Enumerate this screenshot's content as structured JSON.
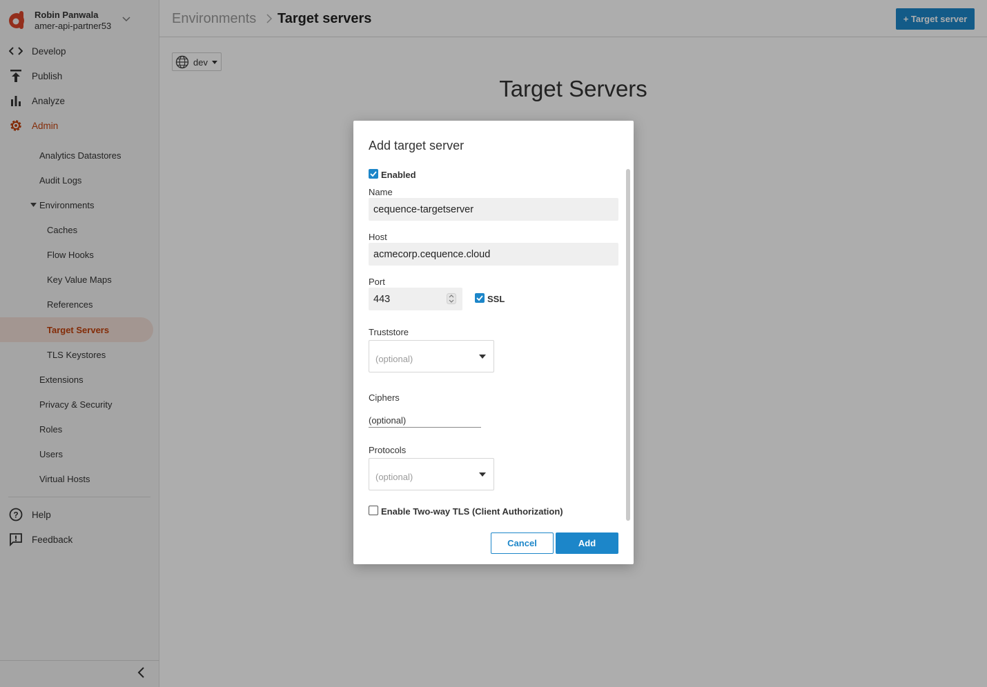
{
  "user": {
    "name": "Robin Panwala",
    "org": "amer-api-partner53"
  },
  "nav": [
    {
      "label": "Develop",
      "icon": "code-icon"
    },
    {
      "label": "Publish",
      "icon": "publish-icon"
    },
    {
      "label": "Analyze",
      "icon": "bar-chart-icon"
    },
    {
      "label": "Admin",
      "icon": "gear-icon",
      "active": true
    }
  ],
  "admin_items": {
    "analytics_datastores": "Analytics Datastores",
    "audit_logs": "Audit Logs",
    "environments": "Environments",
    "caches": "Caches",
    "flow_hooks": "Flow Hooks",
    "key_value_maps": "Key Value Maps",
    "references": "References",
    "target_servers": "Target Servers",
    "tls_keystores": "TLS Keystores",
    "extensions": "Extensions",
    "privacy_security": "Privacy & Security",
    "roles": "Roles",
    "users": "Users",
    "virtual_hosts": "Virtual Hosts"
  },
  "footer_nav": {
    "help": "Help",
    "feedback": "Feedback"
  },
  "header": {
    "breadcrumb_parent": "Environments",
    "breadcrumb_current": "Target servers",
    "add_button": "+ Target server"
  },
  "main": {
    "env_value": "dev",
    "heading": "Target Servers"
  },
  "dialog": {
    "title": "Add target server",
    "enabled_label": "Enabled",
    "name_label": "Name",
    "name_value": "cequence-targetserver",
    "host_label": "Host",
    "host_value": "acmecorp.cequence.cloud",
    "port_label": "Port",
    "port_value": "443",
    "ssl_label": "SSL",
    "truststore_label": "Truststore",
    "truststore_placeholder": "(optional)",
    "ciphers_label": "Ciphers",
    "ciphers_placeholder": "(optional)",
    "protocols_label": "Protocols",
    "protocols_placeholder": "(optional)",
    "two_way_tls_label": "Enable Two-way TLS (Client Authorization)",
    "cancel": "Cancel",
    "add": "Add"
  },
  "colors": {
    "accent": "#1c86c9",
    "admin_active": "#c2410c",
    "logo": "#d9442a"
  }
}
